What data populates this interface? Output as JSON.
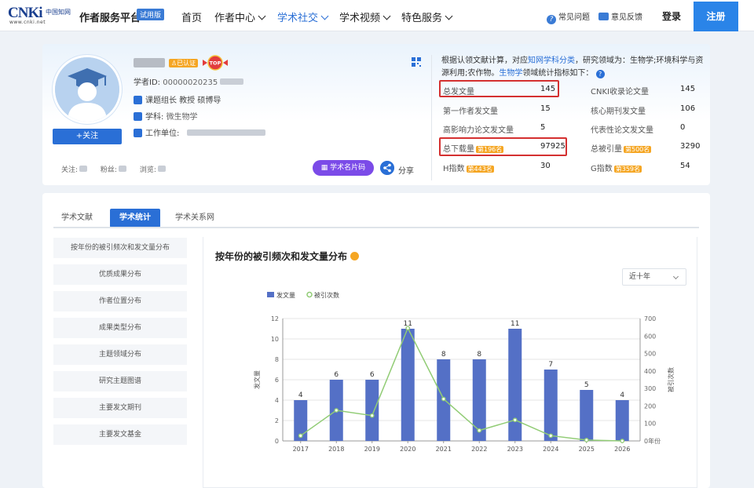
{
  "header": {
    "logo_text": "CNKi",
    "logo_cn": "中国知网",
    "logo_url": "www.cnki.net",
    "platform": "作者服务平台",
    "trial_badge": "试用版",
    "nav": [
      {
        "label": "首页"
      },
      {
        "label": "作者中心"
      },
      {
        "label": "学术社交"
      },
      {
        "label": "学术视频"
      },
      {
        "label": "特色服务"
      }
    ],
    "faq": "常见问题",
    "feedback": "意见反馈",
    "login": "登录",
    "register": "注册"
  },
  "profile": {
    "follow_button": "+关注",
    "verified_badge": "已认证",
    "top_badge": "TOP",
    "scholar_id_label": "学者ID:",
    "scholar_id": "00000020235",
    "roles": "课题组长 教授 硕博导",
    "subject_label": "学科:",
    "subject": "微生物学",
    "unit_label": "工作单位:",
    "follows_label": "关注:",
    "fans_label": "粉丝:",
    "views_label": "浏览:",
    "card_button": "学术名片码",
    "share": "分享",
    "intro_1": "根据认领文献计算，对应",
    "intro_link": "知网学科分类",
    "intro_2": "，研究领域为：生物学;环境科学与资源利用;农作物。",
    "intro_subject": "生物学",
    "intro_3": "领域统计指标如下：",
    "intro_q": "?",
    "metrics": [
      {
        "label": "总发文量",
        "value": "145",
        "rank": ""
      },
      {
        "label": "CNKI收录论文量",
        "value": "145",
        "rank": ""
      },
      {
        "label": "第一作者发文量",
        "value": "15",
        "rank": ""
      },
      {
        "label": "核心期刊发文量",
        "value": "106",
        "rank": ""
      },
      {
        "label": "高影响力论文发文量",
        "value": "5",
        "rank": ""
      },
      {
        "label": "代表性论文发文量",
        "value": "0",
        "rank": ""
      },
      {
        "label": "总下载量",
        "value": "97925",
        "rank": "第196名"
      },
      {
        "label": "总被引量",
        "value": "3290",
        "rank": "第500名"
      },
      {
        "label": "H指数",
        "value": "30",
        "rank": "第443名"
      },
      {
        "label": "G指数",
        "value": "54",
        "rank": "第359名"
      }
    ]
  },
  "tabs": [
    {
      "label": "学术文献"
    },
    {
      "label": "学术统计"
    },
    {
      "label": "学术关系网"
    }
  ],
  "side_menu": [
    "按年份的被引频次和发文量分布",
    "优质成果分布",
    "作者位置分布",
    "成果类型分布",
    "主题领域分布",
    "研究主题图谱",
    "主要发文期刊",
    "主要发文基金"
  ],
  "chart_panel": {
    "title": "按年份的被引频次和发文量分布",
    "range_select": "近十年"
  },
  "chart_data": {
    "type": "bar",
    "categories": [
      "2017",
      "2018",
      "2019",
      "2020",
      "2021",
      "2022",
      "2023",
      "2024",
      "2025",
      "2026"
    ],
    "series": [
      {
        "name": "发文量",
        "type": "bar",
        "axis": "left",
        "values": [
          4,
          6,
          6,
          11,
          8,
          8,
          11,
          7,
          5,
          4
        ],
        "color": "#5470c6"
      },
      {
        "name": "被引次数",
        "type": "line",
        "axis": "right",
        "values": [
          30,
          175,
          145,
          645,
          240,
          60,
          120,
          30,
          5,
          0
        ],
        "color": "#91cc75"
      }
    ],
    "ylabel": "发文量",
    "y2label": "被引次数",
    "x_end_label": "0年份",
    "ylim": [
      0,
      12
    ],
    "y2lim": [
      0,
      700
    ],
    "yticks": [
      0,
      2,
      4,
      6,
      8,
      10,
      12
    ],
    "y2ticks": [
      0,
      100,
      200,
      300,
      400,
      500,
      600,
      700
    ],
    "legend_position": "top-left",
    "grid": true
  }
}
